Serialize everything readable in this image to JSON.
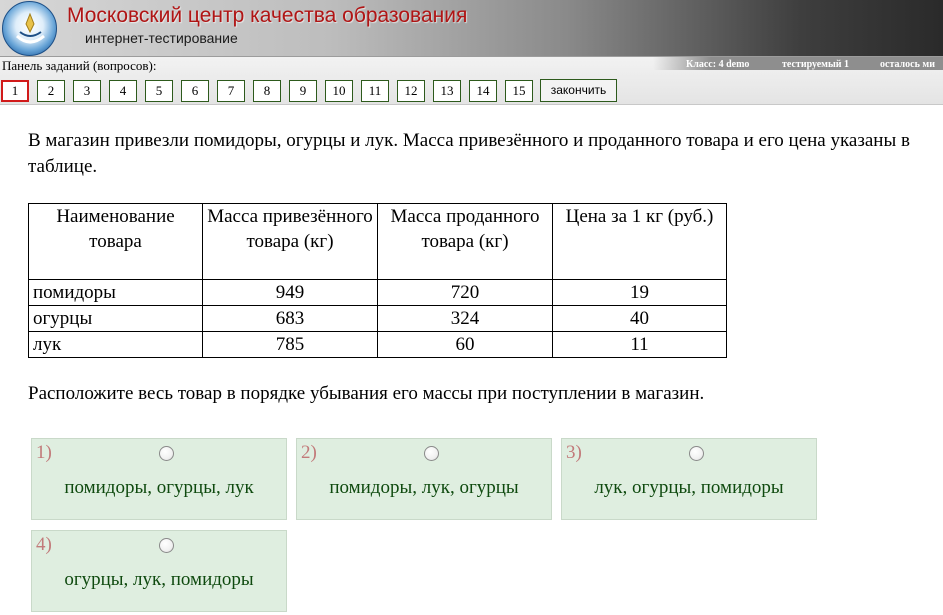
{
  "header": {
    "title": "Московский центр качества образования",
    "subtitle": "интернет-тестирование"
  },
  "panel": {
    "label": "Панель заданий (вопросов):",
    "status": {
      "class_info": "Класс: 4 demo",
      "tested": "тестируемый 1",
      "remaining": "осталось ми"
    },
    "questions": [
      "1",
      "2",
      "3",
      "4",
      "5",
      "6",
      "7",
      "8",
      "9",
      "10",
      "11",
      "12",
      "13",
      "14",
      "15"
    ],
    "active_question": "1",
    "finish_label": "закончить"
  },
  "question": {
    "text": "В магазин привезли помидоры, огурцы и лук. Масса привезённого и проданного товара и его цена указаны в таблице.",
    "table": {
      "headers": [
        "Наименование товара",
        "Масса привезённого товара (кг)",
        "Масса проданного товара (кг)",
        "Цена за 1 кг (руб.)"
      ],
      "rows": [
        [
          "помидоры",
          "949",
          "720",
          "19"
        ],
        [
          "огурцы",
          "683",
          "324",
          "40"
        ],
        [
          "лук",
          "785",
          "60",
          "11"
        ]
      ]
    },
    "instruction": "Расположите весь товар в порядке убывания его массы при поступлении в магазин."
  },
  "options": [
    {
      "num": "1)",
      "text": "помидоры, огурцы, лук"
    },
    {
      "num": "2)",
      "text": "помидоры, лук, огурцы"
    },
    {
      "num": "3)",
      "text": "лук, огурцы, помидоры"
    },
    {
      "num": "4)",
      "text": "огурцы, лук, помидоры"
    }
  ],
  "colors": {
    "title": "#b01515",
    "button_border": "#2d5a1c",
    "active_border": "#d11a1a",
    "option_bg": "#dfeee0",
    "option_text": "#0f4a0f",
    "option_num": "#c27a7a"
  }
}
